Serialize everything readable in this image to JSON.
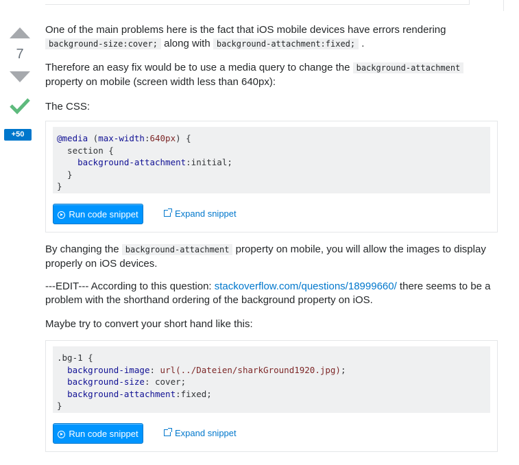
{
  "vote": {
    "count": "7",
    "bounty": "+50"
  },
  "post": {
    "p1_text": "One of the main problems here is the fact that iOS mobile devices have errors rendering",
    "p1_code_a": "background-size:cover;",
    "p1_mid": " along with ",
    "p1_code_b": "background-attachment:fixed;",
    "p1_end": " .",
    "p2_text": "Therefore an easy fix would be to use a media query to change the ",
    "p2_code": "background-attachment",
    "p2_end": "property on mobile (screen width less than 640px):",
    "p3_text": "The CSS:",
    "p4_start": "By changing the ",
    "p4_code": "background-attachment",
    "p4_end": " property on mobile, you will allow the images to display properly on iOS devices.",
    "p5_start": "---EDIT--- According to this question: ",
    "p5_link": "stackoverflow.com/questions/18999660/",
    "p5_end": " there seems to be a problem with the shorthand ordering of the background property on iOS.",
    "p6_text": "Maybe try to convert your short hand like this:"
  },
  "snippet1": {
    "l1_kw": "@media",
    "l1_rest_a": " (",
    "l1_prop": "max-width",
    "l1_rest_b": ":",
    "l1_val": "640px",
    "l1_rest_c": ") {",
    "l2": "  section {",
    "l3_indent": "    ",
    "l3_prop": "background-attachment",
    "l3_val": ":initial;",
    "l4": "  }",
    "l5": "}",
    "run_label": "Run code snippet",
    "expand_label": "Expand snippet"
  },
  "snippet2": {
    "l1": ".bg-1 {",
    "l2_indent": "  ",
    "l2_prop": "background-image",
    "l2_colon": ": ",
    "l2_val": "url(../Dateien/sharkGround1920.jpg)",
    "l2_end": ";",
    "l3_indent": "  ",
    "l3_prop": "background-size",
    "l3_val": ": cover;",
    "l4_indent": "  ",
    "l4_prop": "background-attachment",
    "l4_val": ":fixed;",
    "l5": "}",
    "run_label": "Run code snippet",
    "expand_label": "Expand snippet"
  },
  "icons": {
    "upvote": "arrow-up-icon",
    "downvote": "arrow-down-icon",
    "accepted": "checkmark-icon",
    "run": "play-circle-icon",
    "expand": "external-link-icon"
  },
  "colors": {
    "accent": "#0095ff",
    "link": "#0077cc",
    "accepted": "#5eba7d",
    "code_bg": "#eff0f1"
  }
}
